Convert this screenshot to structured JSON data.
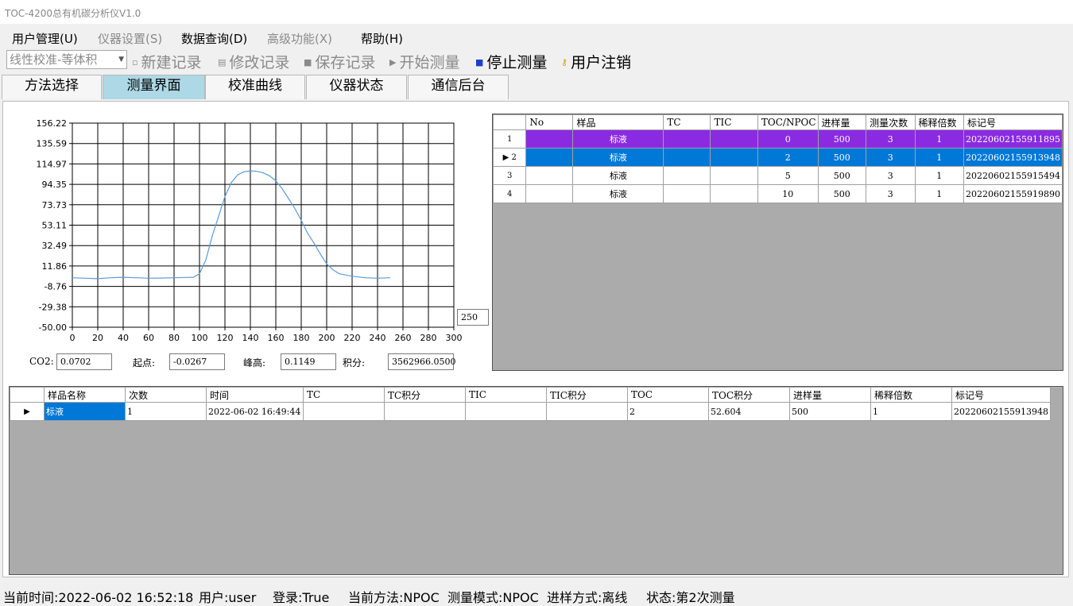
{
  "window": {
    "title": "TOC-4200总有机碳分析仪V1.0"
  },
  "menu": [
    {
      "label": "用户管理(U)",
      "enabled": true
    },
    {
      "label": "仪器设置(S)",
      "enabled": false
    },
    {
      "label": "数据查询(D)",
      "enabled": true
    },
    {
      "label": "高级功能(X)",
      "enabled": false
    },
    {
      "label": "帮助(H)",
      "enabled": true
    }
  ],
  "toolbar": {
    "method": "线性校准-等体积",
    "buttons": [
      {
        "label": "新建记录",
        "icon": "new-record-icon",
        "enabled": false
      },
      {
        "label": "修改记录",
        "icon": "edit-record-icon",
        "enabled": false
      },
      {
        "label": "保存记录",
        "icon": "save-icon",
        "enabled": false
      },
      {
        "label": "开始测量",
        "icon": "play-icon",
        "enabled": false
      },
      {
        "label": "停止测量",
        "icon": "stop-icon",
        "enabled": true
      },
      {
        "label": "用户注销",
        "icon": "key-icon",
        "enabled": true
      }
    ]
  },
  "tabs": [
    {
      "label": "方法选择",
      "active": false
    },
    {
      "label": "测量界面",
      "active": true
    },
    {
      "label": "校准曲线",
      "active": false
    },
    {
      "label": "仪器状态",
      "active": false
    },
    {
      "label": "通信后台",
      "active": false
    }
  ],
  "chart_data": {
    "type": "line",
    "x": [
      0,
      10,
      20,
      30,
      40,
      50,
      60,
      70,
      80,
      90,
      95,
      100,
      105,
      110,
      115,
      120,
      125,
      130,
      135,
      140,
      145,
      150,
      155,
      160,
      165,
      170,
      175,
      180,
      185,
      190,
      195,
      200,
      205,
      210,
      220,
      230,
      240,
      250
    ],
    "series": [
      {
        "values": [
          0,
          -0.5,
          -1,
          0,
          0.5,
          0,
          -0.5,
          -0.3,
          0,
          0.3,
          0.5,
          4,
          18,
          42,
          62,
          82,
          96,
          104,
          107,
          108,
          107.5,
          106,
          103,
          98,
          90,
          80,
          70,
          58,
          45,
          35,
          24,
          14,
          8,
          4,
          1.5,
          0,
          -0.5,
          0
        ]
      }
    ],
    "xlim": [
      0,
      300
    ],
    "ylim": [
      -50,
      156.22
    ],
    "x_ticks": [
      0,
      20,
      40,
      60,
      80,
      100,
      120,
      140,
      160,
      180,
      200,
      220,
      240,
      260,
      280,
      300
    ],
    "y_ticks": [
      "156.22",
      "135.59",
      "114.97",
      "94.35",
      "73.73",
      "53.11",
      "32.49",
      "11.86",
      "-8.76",
      "-29.38",
      "-50.00"
    ],
    "grid": true,
    "line_color": "#5b9bd5"
  },
  "x_max_value": "250",
  "readouts": {
    "co2_label": "CO2:",
    "co2": "0.0702",
    "start_label": "起点:",
    "start": "-0.0267",
    "peak_label": "峰高:",
    "peak": "0.1149",
    "integral_label": "积分:",
    "integral": "3562966.0500"
  },
  "sample_table": {
    "headers": [
      "No",
      "样品",
      "TC",
      "TIC",
      "TOC/NPOC",
      "进样量",
      "测量次数",
      "稀释倍数",
      "标记号"
    ],
    "rows": [
      {
        "no": "1",
        "sample": "标液",
        "tc": "",
        "tic": "",
        "toc": "0",
        "volume": "500",
        "count": "3",
        "dilution": "1",
        "tag": "20220602155911895",
        "style": "purple",
        "current": false
      },
      {
        "no": "2",
        "sample": "标液",
        "tc": "",
        "tic": "",
        "toc": "2",
        "volume": "500",
        "count": "3",
        "dilution": "1",
        "tag": "20220602155913948",
        "style": "blue",
        "current": true
      },
      {
        "no": "3",
        "sample": "标液",
        "tc": "",
        "tic": "",
        "toc": "5",
        "volume": "500",
        "count": "3",
        "dilution": "1",
        "tag": "20220602155915494",
        "style": "",
        "current": false
      },
      {
        "no": "4",
        "sample": "标液",
        "tc": "",
        "tic": "",
        "toc": "10",
        "volume": "500",
        "count": "3",
        "dilution": "1",
        "tag": "20220602155919890",
        "style": "",
        "current": false
      }
    ]
  },
  "result_table": {
    "headers": [
      "样品名称",
      "次数",
      "时间",
      "TC",
      "TC积分",
      "TIC",
      "TIC积分",
      "TOC",
      "TOC积分",
      "进样量",
      "稀释倍数",
      "标记号"
    ],
    "rows": [
      [
        "标液",
        "1",
        "2022-06-02 16:49:44",
        "",
        "",
        "",
        "",
        "2",
        "52.604",
        "500",
        "1",
        "20220602155913948"
      ]
    ]
  },
  "status": {
    "time": "当前时间:2022-06-02 16:52:18",
    "user": "用户:user",
    "login": "登录:True",
    "method": "当前方法:NPOC",
    "mode": "测量模式:NPOC",
    "inject": "进样方式:离线",
    "state": "状态:第2次测量"
  }
}
